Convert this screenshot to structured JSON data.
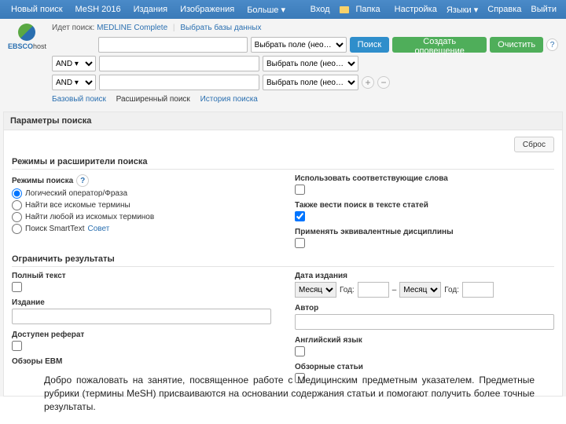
{
  "topbar": {
    "left": [
      "Новый поиск",
      "MeSH 2016",
      "Издания",
      "Изображения",
      "Больше ▾"
    ],
    "right": [
      "Вход",
      "Папка",
      "Настройка",
      "Языки ▾",
      "Справка",
      "Выйти"
    ]
  },
  "header": {
    "searching_label": "Идет поиск:",
    "db_name": "MEDLINE Complete",
    "choose_db": "Выбрать базы данных"
  },
  "search": {
    "field_select": "Выбрать поле (нео… ▾",
    "bool": "AND ▾",
    "buttons": {
      "search": "Поиск",
      "alert": "Создать оповещение",
      "clear": "Очистить"
    }
  },
  "subnav": [
    "Базовый поиск",
    "Расширенный поиск",
    "История поиска"
  ],
  "options": {
    "title": "Параметры поиска",
    "reset": "Сброс",
    "modes_section": "Режимы и расширители поиска",
    "modes_label": "Режимы поиска",
    "modes": [
      "Логический оператор/Фраза",
      "Найти все искомые термины",
      "Найти любой из искомых терминов",
      "Поиск SmartText"
    ],
    "hint": "Совет",
    "expanders": {
      "related": "Использовать соответствующие слова",
      "fulltext": "Также вести поиск в тексте статей",
      "equiv": "Применять эквивалентные дисциплины"
    },
    "limits_section": "Ограничить результаты",
    "limits": {
      "fulltext": "Полный текст",
      "publication": "Издание",
      "abstract": "Доступен реферат",
      "ebm": "Обзоры EBM",
      "pubdate": "Дата издания",
      "month": "Месяц",
      "year": "Год:",
      "author": "Автор",
      "english": "Английский язык",
      "review": "Обзорные статьи"
    }
  },
  "caption": "Добро пожаловать на занятие, посвященное работе с Медицинским предметным указателем. Предметные рубрики (термины MeSH) присваиваются на основании содержания статьи и помогают получить более точные результаты."
}
